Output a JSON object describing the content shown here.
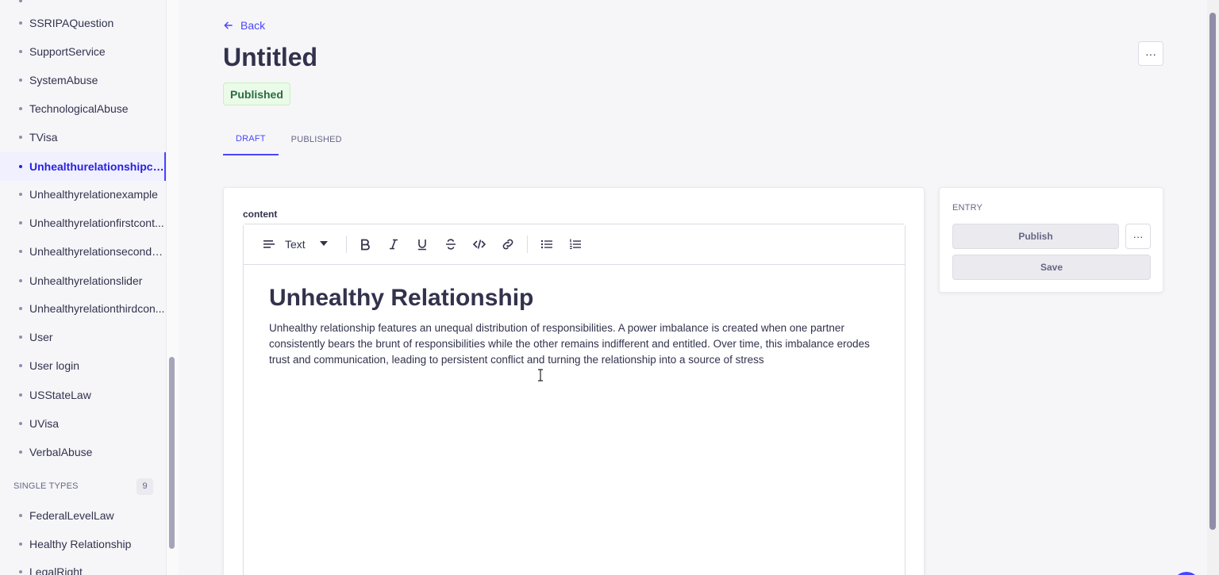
{
  "sidebar": {
    "items": [
      {
        "label": "SSRIPAQuestion"
      },
      {
        "label": "SupportService"
      },
      {
        "label": "SystemAbuse"
      },
      {
        "label": "TechnologicalAbuse"
      },
      {
        "label": "TVisa"
      },
      {
        "label": "Unhealthurelationshipco..."
      },
      {
        "label": "Unhealthyrelationexample"
      },
      {
        "label": "Unhealthyrelationfirstcont..."
      },
      {
        "label": "Unhealthyrelationsecondc..."
      },
      {
        "label": "Unhealthyrelationslider"
      },
      {
        "label": "Unhealthyrelationthirdcon..."
      },
      {
        "label": "User"
      },
      {
        "label": "User login"
      },
      {
        "label": "USStateLaw"
      },
      {
        "label": "UVisa"
      },
      {
        "label": "VerbalAbuse"
      }
    ],
    "single_types": {
      "title": "SINGLE TYPES",
      "count": "9",
      "items": [
        {
          "label": "FederalLevelLaw"
        },
        {
          "label": "Healthy Relationship"
        },
        {
          "label": "LegalRight"
        }
      ]
    }
  },
  "header": {
    "back_label": "Back",
    "title": "Untitled",
    "status": "Published",
    "more_label": "···"
  },
  "tabs": [
    {
      "label": "DRAFT"
    },
    {
      "label": "PUBLISHED"
    }
  ],
  "editor": {
    "field_label": "content",
    "block_type": "Text",
    "heading": "Unhealthy Relationship",
    "paragraph": "Unhealthy relationship features an unequal distribution of responsibilities. A power imbalance is created when one partner consistently bears the brunt of responsibilities while the other remains indifferent and entitled. Over time, this imbalance erodes trust and communication, leading to persistent conflict and turning the relationship into a source of stress"
  },
  "entry_panel": {
    "title": "ENTRY",
    "publish_label": "Publish",
    "more_label": "···",
    "save_label": "Save"
  },
  "colors": {
    "primary": "#4945ff",
    "success_bg": "#eafbe7",
    "success_text": "#2f6846",
    "text": "#32324d"
  }
}
